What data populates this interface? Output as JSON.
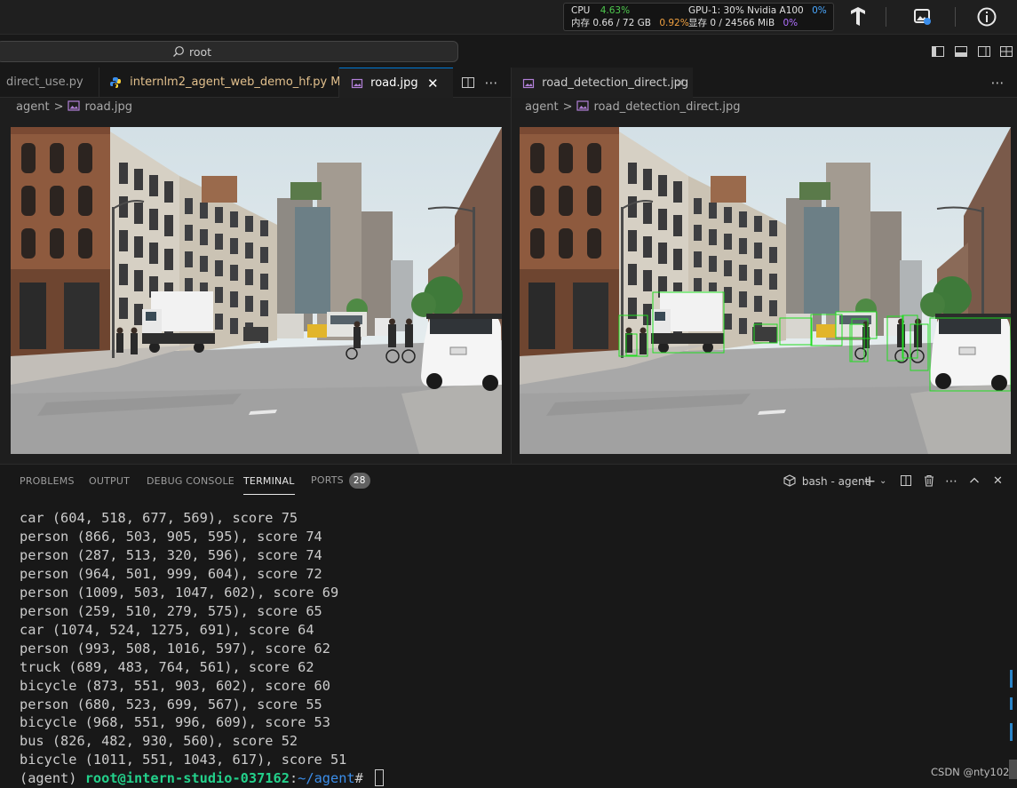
{
  "system_monitor": {
    "cpu_label": "CPU",
    "cpu_value": "4.63%",
    "mem_label": "内存 0.66 / 72 GB",
    "mem_value": "0.92%",
    "gpu_label": "GPU-1: 30% Nvidia A100",
    "gpu_value": "0%",
    "vram_label": "显存 0 / 24566 MiB",
    "vram_value": "0%"
  },
  "command_center": {
    "text": "root"
  },
  "left_group": {
    "tabs": [
      {
        "label": "direct_use.py"
      },
      {
        "label": "internlm2_agent_web_demo_hf.py",
        "status": "M"
      },
      {
        "label": "road.jpg"
      }
    ],
    "breadcrumb": [
      "agent",
      "road.jpg"
    ]
  },
  "right_group": {
    "tabs": [
      {
        "label": "road_detection_direct.jpg"
      }
    ],
    "breadcrumb": [
      "agent",
      "road_detection_direct.jpg"
    ]
  },
  "panel": {
    "tabs": [
      "PROBLEMS",
      "OUTPUT",
      "DEBUG CONSOLE",
      "TERMINAL",
      "PORTS"
    ],
    "active_tab": "TERMINAL",
    "ports_count": "28",
    "terminal_name": "bash - agent"
  },
  "terminal": {
    "lines": [
      "car (604, 518, 677, 569), score 75",
      "person (866, 503, 905, 595), score 74",
      "person (287, 513, 320, 596), score 74",
      "person (964, 501, 999, 604), score 72",
      "person (1009, 503, 1047, 602), score 69",
      "person (259, 510, 279, 575), score 65",
      "car (1074, 524, 1275, 691), score 64",
      "person (993, 508, 1016, 597), score 62",
      "truck (689, 483, 764, 561), score 62",
      "bicycle (873, 551, 903, 602), score 60",
      "person (680, 523, 699, 567), score 55",
      "bicycle (968, 551, 996, 609), score 53",
      "bus (826, 482, 930, 560), score 52",
      "bicycle (1011, 551, 1043, 617), score 51"
    ],
    "prompt_env": "(agent) ",
    "prompt_user": "root@intern-studio-037162",
    "prompt_sep": ":",
    "prompt_path": "~/agent",
    "prompt_symbol": "# "
  },
  "watermark": "CSDN @nty102",
  "colors": {
    "accent": "#0078d4",
    "terminal_user": "#23d18b",
    "terminal_path": "#3b8eea",
    "detection_box": "#22dd22",
    "modified": "#e2c08d"
  }
}
